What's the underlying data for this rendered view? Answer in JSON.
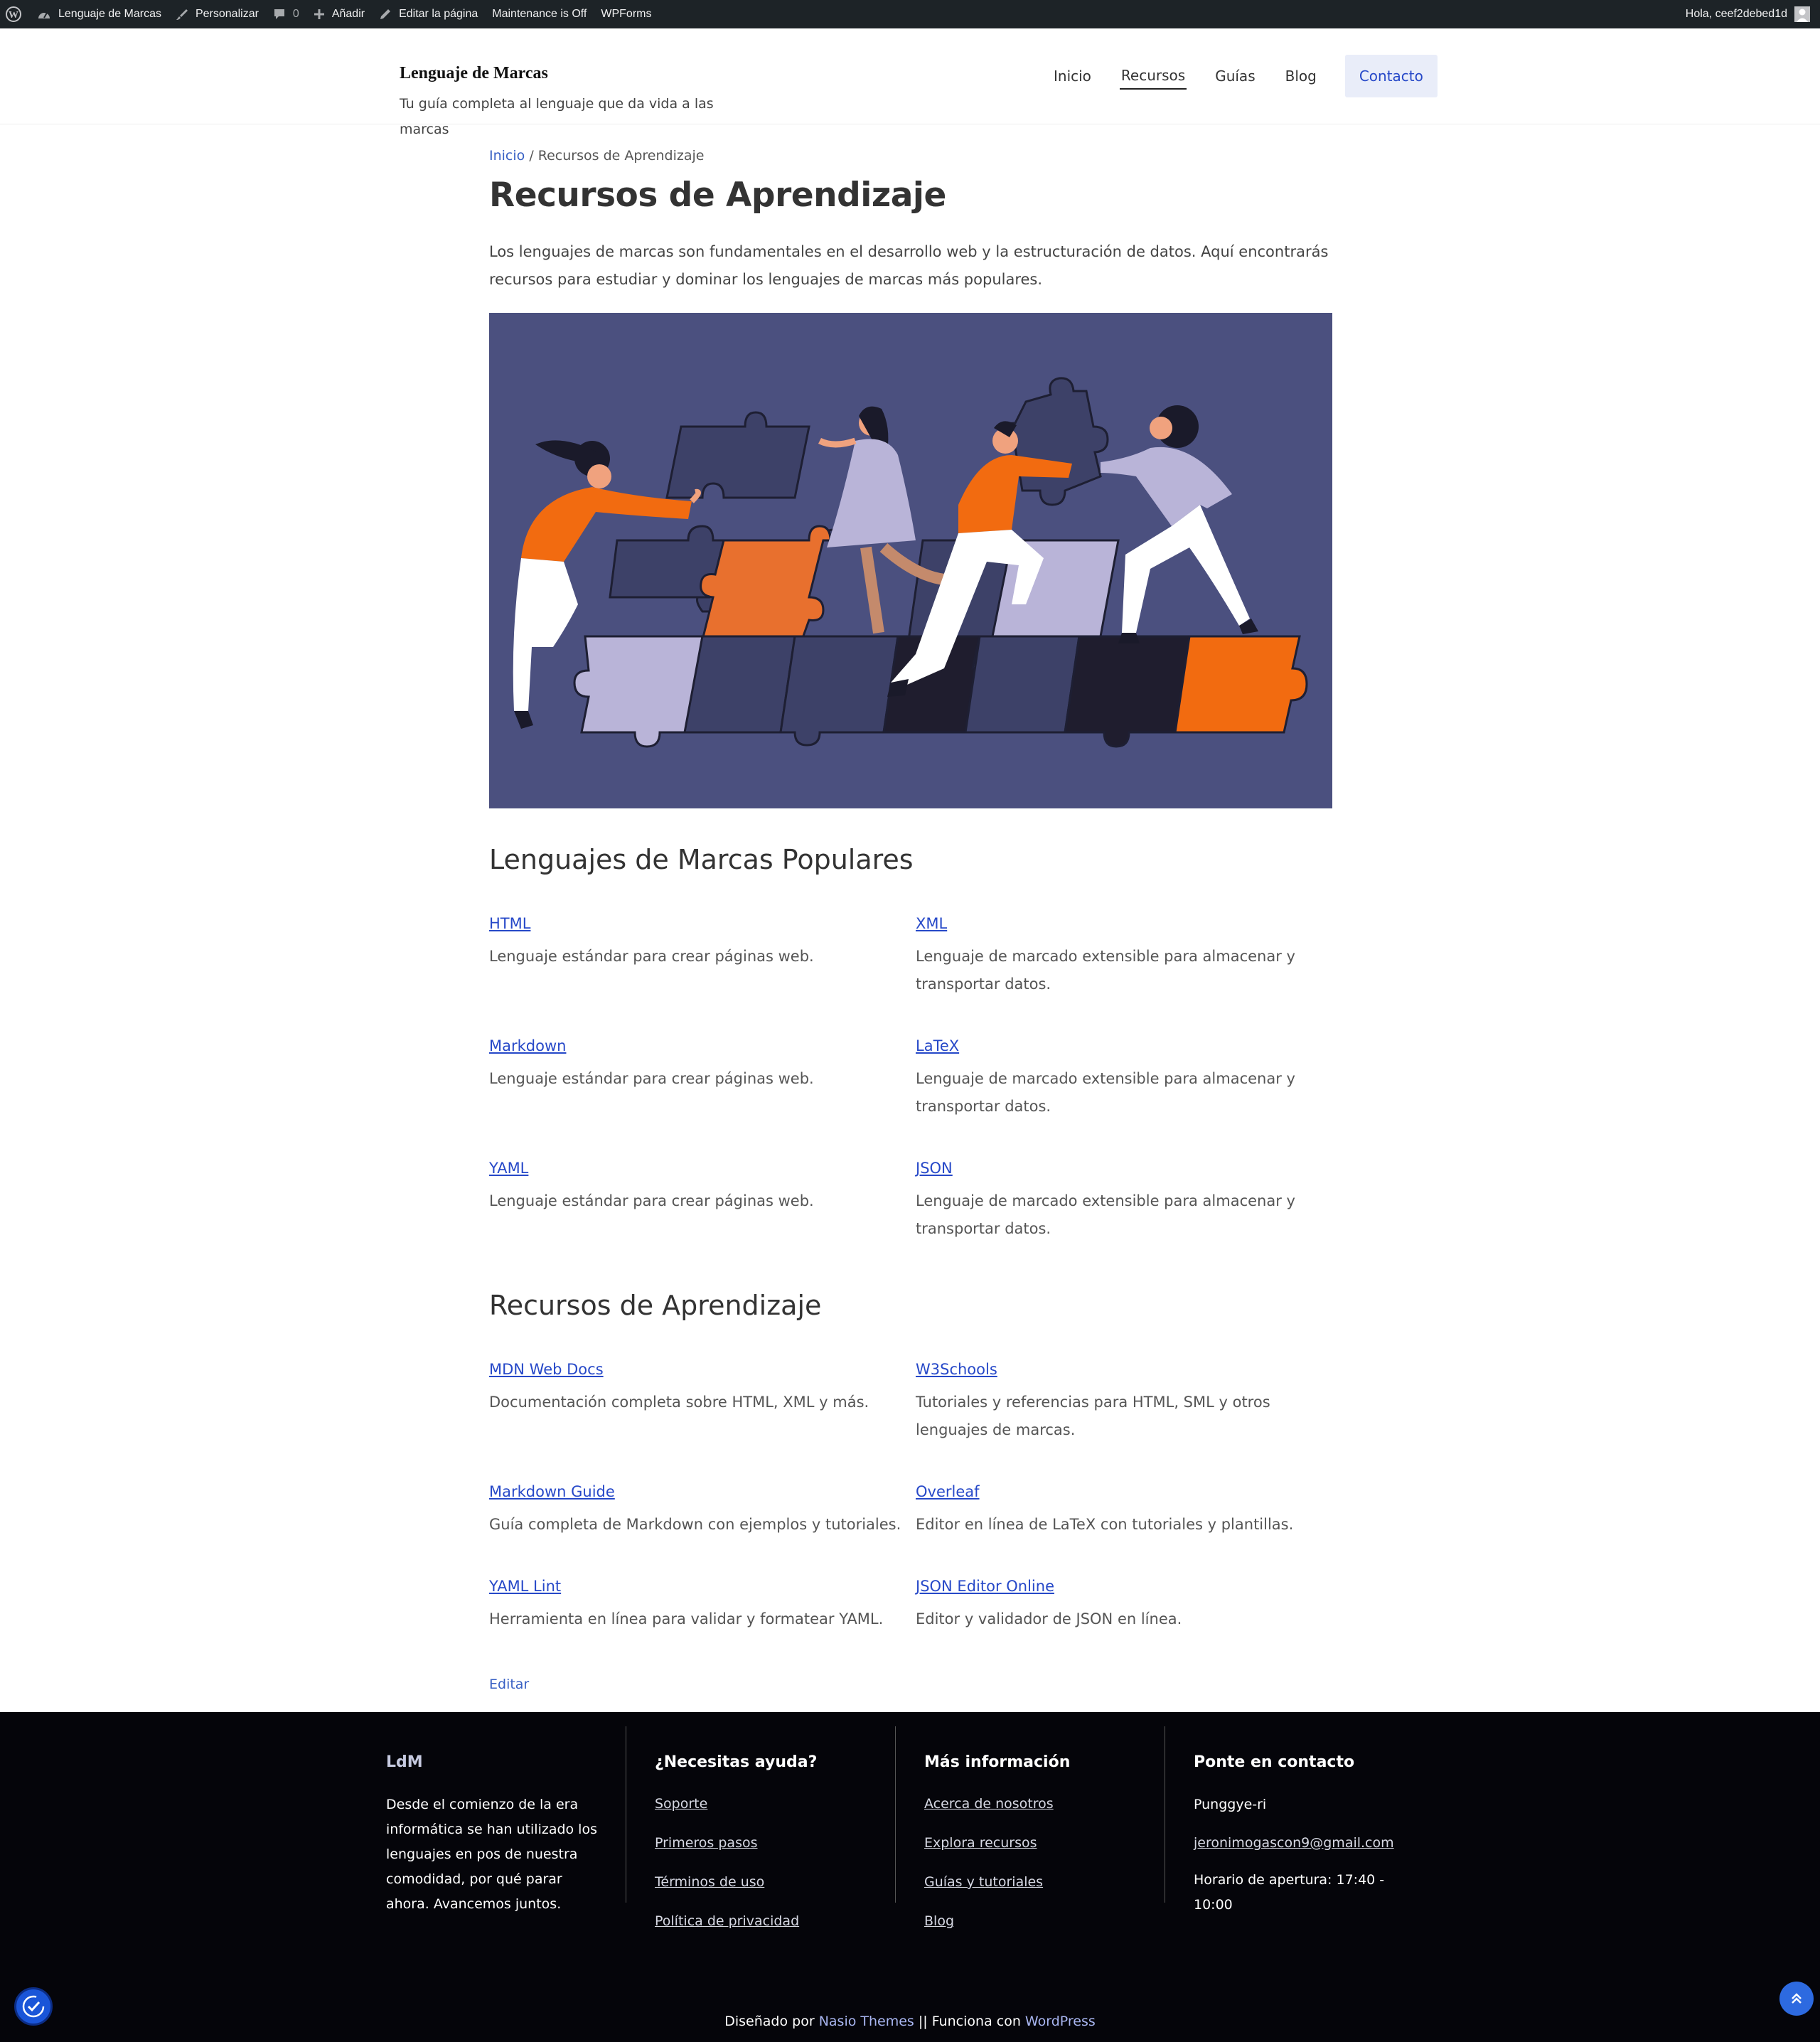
{
  "admin_bar": {
    "site_name": "Lenguaje de Marcas",
    "customize": "Personalizar",
    "comments_count": "0",
    "add_new": "Añadir",
    "edit_page": "Editar la página",
    "maintenance": "Maintenance is Off",
    "wpforms": "WPForms",
    "greeting": "Hola, ceef2debed1d"
  },
  "header": {
    "site_title": "Lenguaje de Marcas",
    "tagline": "Tu guía completa al lenguaje que da vida a las marcas",
    "nav": [
      "Inicio",
      "Recursos",
      "Guías",
      "Blog"
    ],
    "nav_active": "Recursos",
    "cta": "Contacto"
  },
  "breadcrumb": {
    "home": "Inicio",
    "separator": " / ",
    "current": "Recursos de Aprendizaje"
  },
  "page": {
    "title": "Recursos de Aprendizaje",
    "intro": "Los lenguajes de marcas son fundamentales en el desarrollo web y la estructuración de datos. Aquí encontrarás recursos para estudiar y dominar los lenguajes de marcas más populares.",
    "hero_image": "illustration-people-assembling-puzzle",
    "edit": "Editar"
  },
  "languages": {
    "heading": "Lenguajes de Marcas Populares",
    "items": [
      {
        "name": "HTML",
        "desc": "Lenguaje estándar para crear páginas web."
      },
      {
        "name": "XML",
        "desc": "Lenguaje de marcado extensible para almacenar y transportar datos."
      },
      {
        "name": "Markdown",
        "desc": "Lenguaje estándar para crear páginas web."
      },
      {
        "name": "LaTeX",
        "desc": "Lenguaje de marcado extensible para almacenar y transportar datos."
      },
      {
        "name": "YAML",
        "desc": "Lenguaje estándar para crear páginas web."
      },
      {
        "name": "JSON",
        "desc": "Lenguaje de marcado extensible para almacenar y transportar datos."
      }
    ]
  },
  "resources": {
    "heading": "Recursos de Aprendizaje",
    "items": [
      {
        "name": "MDN Web Docs",
        "desc": "Documentación completa sobre HTML, XML y más."
      },
      {
        "name": "W3Schools",
        "desc": "Tutoriales y referencias para HTML, SML y otros lenguajes de marcas."
      },
      {
        "name": "Markdown Guide",
        "desc": "Guía completa de Markdown con ejemplos y tutoriales."
      },
      {
        "name": "Overleaf",
        "desc": "Editor en línea de LaTeX con tutoriales y plantillas."
      },
      {
        "name": "YAML Lint",
        "desc": "Herramienta en línea para validar y formatear YAML."
      },
      {
        "name": "JSON Editor Online",
        "desc": "Editor y validador de JSON en línea."
      }
    ]
  },
  "footer": {
    "col1": {
      "title": "LdM",
      "text": "Desde el comienzo de la era informática se han utilizado los lenguajes en pos de nuestra comodidad, por qué parar ahora. Avancemos juntos."
    },
    "col2": {
      "title": "¿Necesitas ayuda?",
      "links": [
        "Soporte",
        "Primeros pasos",
        "Términos de uso",
        "Política de privacidad"
      ]
    },
    "col3": {
      "title": "Más información",
      "links": [
        "Acerca de nosotros",
        "Explora recursos",
        "Guías y tutoriales",
        "Blog"
      ]
    },
    "col4": {
      "title": "Ponte en contacto",
      "location": "Punggye-ri",
      "email": "jeronimogascon9@gmail.com",
      "hours": "Horario de apertura: 17:40 - 10:00"
    },
    "credit": {
      "designed_by": "Diseñado por ",
      "theme": "Nasio Themes",
      "sep": " || Funciona con ",
      "platform": "WordPress"
    }
  },
  "colors": {
    "accent": "#2648c8",
    "hero_bg": "#4b507f",
    "orange": "#f26b10",
    "lavender": "#b9b4d8",
    "footer_bg": "#05050a"
  }
}
